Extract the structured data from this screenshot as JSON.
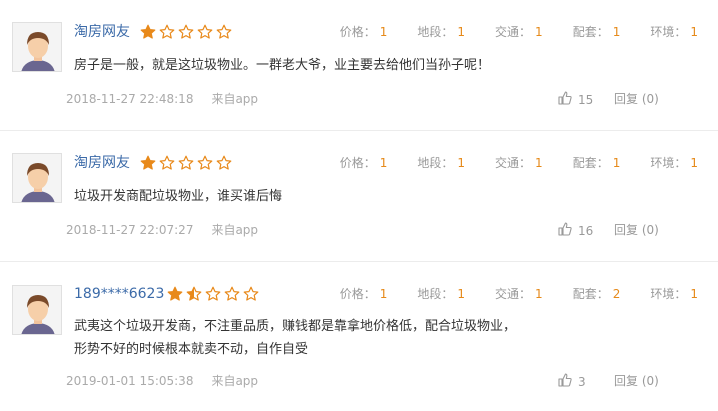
{
  "reviews": [
    {
      "username": "淘房网友",
      "rating": 1,
      "scores": [
        {
          "label": "价格：",
          "value": "1"
        },
        {
          "label": "地段：",
          "value": "1"
        },
        {
          "label": "交通：",
          "value": "1"
        },
        {
          "label": "配套：",
          "value": "1"
        },
        {
          "label": "环境：",
          "value": "1"
        }
      ],
      "content_lines": [
        "房子是一般，就是这垃圾物业。一群老大爷，业主要去给他们当孙子呢！"
      ],
      "timestamp": "2018-11-27 22:48:18",
      "source": "来自app",
      "likes": "15",
      "reply": "回复 (0)"
    },
    {
      "username": "淘房网友",
      "rating": 1,
      "scores": [
        {
          "label": "价格：",
          "value": "1"
        },
        {
          "label": "地段：",
          "value": "1"
        },
        {
          "label": "交通：",
          "value": "1"
        },
        {
          "label": "配套：",
          "value": "1"
        },
        {
          "label": "环境：",
          "value": "1"
        }
      ],
      "content_lines": [
        "垃圾开发商配垃圾物业，谁买谁后悔"
      ],
      "timestamp": "2018-11-27 22:07:27",
      "source": "来自app",
      "likes": "16",
      "reply": "回复 (0)"
    },
    {
      "username": "189****6623",
      "rating": 1.5,
      "scores": [
        {
          "label": "价格：",
          "value": "1"
        },
        {
          "label": "地段：",
          "value": "1"
        },
        {
          "label": "交通：",
          "value": "1"
        },
        {
          "label": "配套：",
          "value": "2"
        },
        {
          "label": "环境：",
          "value": "1"
        }
      ],
      "content_lines": [
        "武夷这个垃圾开发商，不注重品质，赚钱都是靠拿地价格低，配合垃圾物业，",
        "形势不好的时候根本就卖不动，自作自受"
      ],
      "timestamp": "2019-01-01 15:05:38",
      "source": "来自app",
      "likes": "3",
      "reply": "回复 (0)"
    }
  ],
  "colors": {
    "star_filled": "#e8891a",
    "star_empty": "#e8891a",
    "score_value": "#e68a1a",
    "username": "#3b6aa8"
  }
}
